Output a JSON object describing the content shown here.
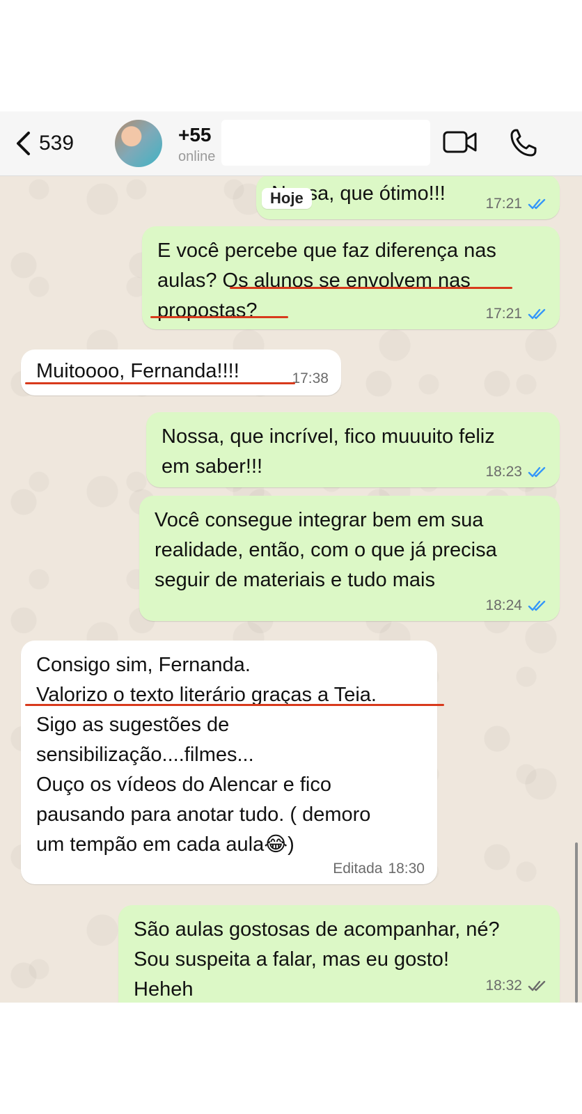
{
  "header": {
    "back_count": "539",
    "contact_name": "+55",
    "contact_status": "online",
    "icons": {
      "back": "chevron-left-icon",
      "video": "video-camera-icon",
      "call": "phone-icon"
    }
  },
  "date_label": "Hoje",
  "colors": {
    "outgoing_bubble": "#dcf8c6",
    "incoming_bubble": "#ffffff",
    "read_ticks": "#3497f9",
    "underline": "#d83a1c"
  },
  "messages": [
    {
      "direction": "out",
      "text": "Nossa, que ótimo!!!",
      "time": "17:21",
      "status": "read"
    },
    {
      "direction": "out",
      "text": "E você percebe que faz diferença nas\naulas? Os alunos se envolvem nas\npropostas?",
      "time": "17:21",
      "status": "read"
    },
    {
      "direction": "in",
      "text": "Muitoooo, Fernanda!!!!",
      "time": "17:38"
    },
    {
      "direction": "out",
      "text": "Nossa, que incrível, fico muuuito feliz\nem saber!!!",
      "time": "18:23",
      "status": "read"
    },
    {
      "direction": "out",
      "text": "Você consegue integrar bem em sua\nrealidade, então, com o que já precisa\nseguir de materiais e tudo mais",
      "time": "18:24",
      "status": "read"
    },
    {
      "direction": "in",
      "text": "Consigo sim, Fernanda.\nValorizo o texto literário graças a Teia.\nSigo as sugestões de\nsensibilização....filmes...\nOuço os vídeos do Alencar e fico\npausando para anotar tudo. ( demoro\num tempão em cada aula😂)",
      "edited_label": "Editada",
      "time": "18:30"
    },
    {
      "direction": "out",
      "text": "São aulas gostosas de acompanhar, né?\nSou suspeita a falar, mas eu gosto!\nHeheh",
      "time": "18:32",
      "status": "delivered"
    }
  ]
}
